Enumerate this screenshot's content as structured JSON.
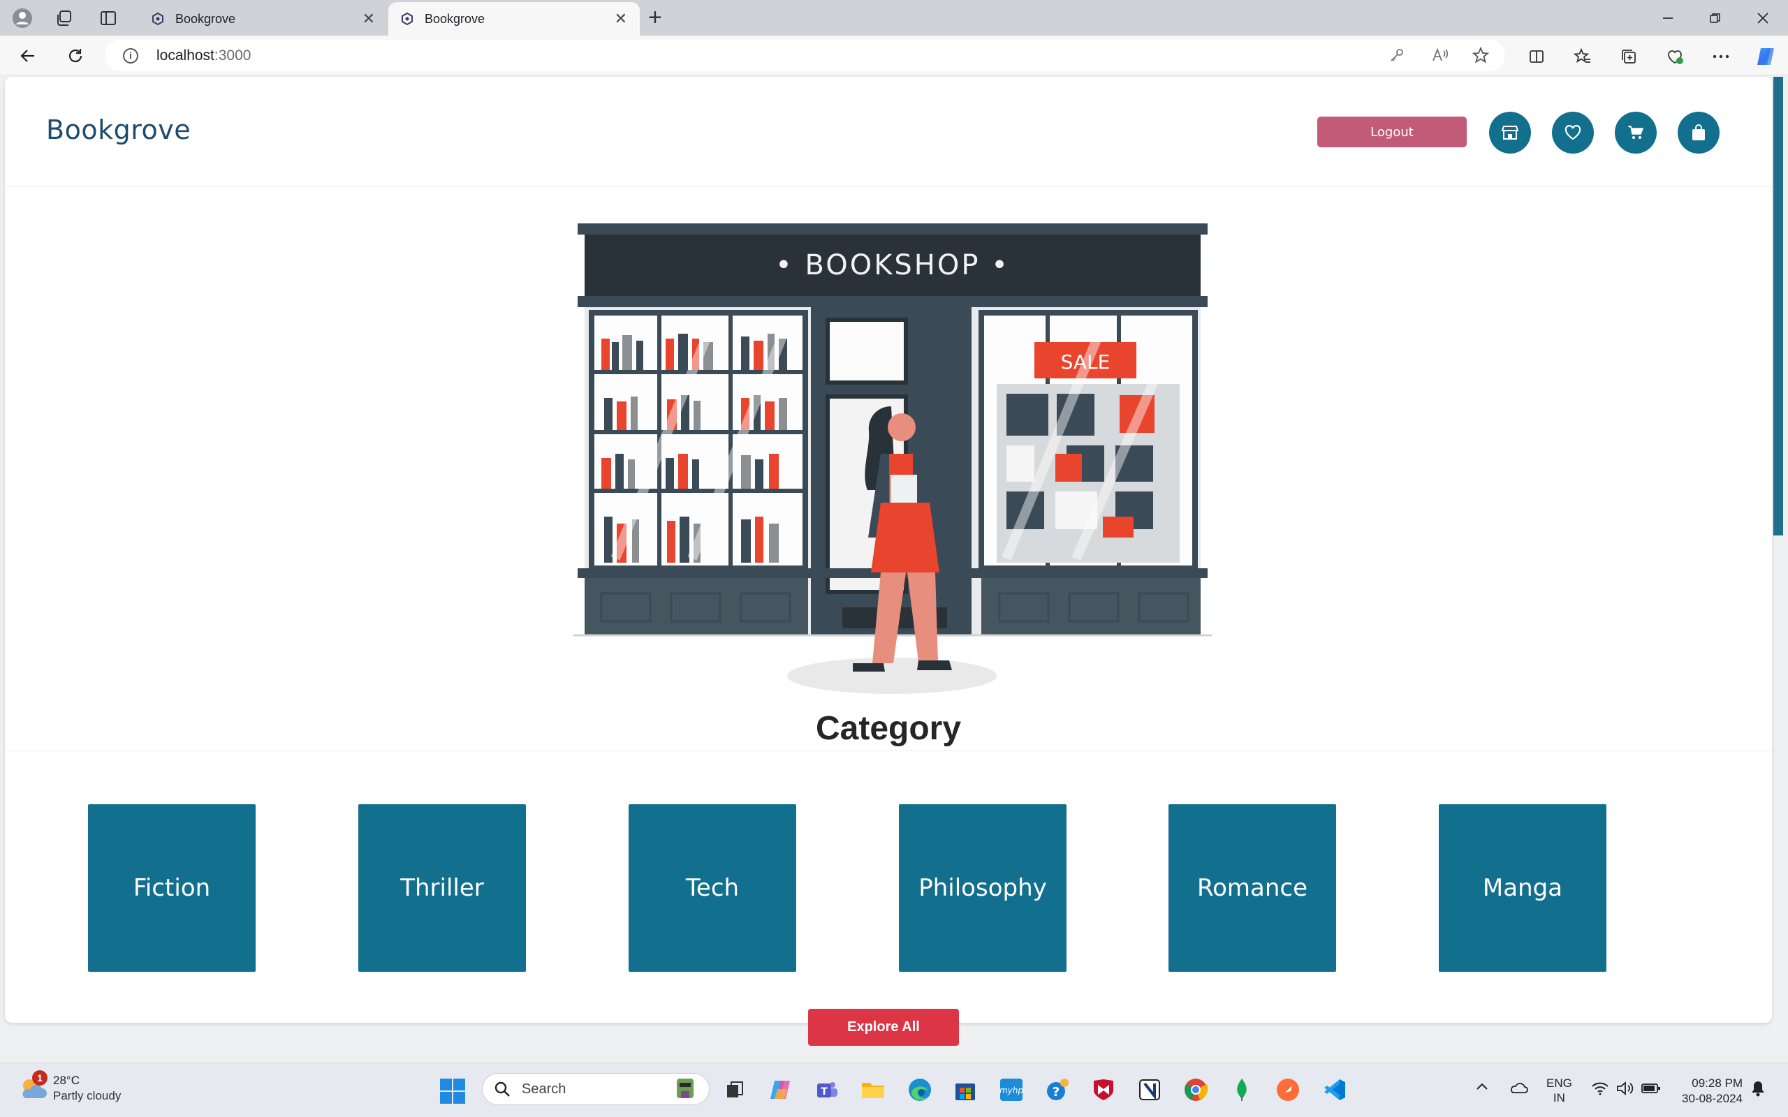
{
  "browser": {
    "tabs": [
      {
        "title": "Bookgrove",
        "active": false
      },
      {
        "title": "Bookgrove",
        "active": true
      }
    ],
    "url_host": "localhost",
    "url_port": ":3000"
  },
  "site": {
    "brand": "Bookgrove",
    "logout_label": "Logout",
    "header_icons": [
      "store-icon",
      "heart-icon",
      "cart-icon",
      "shopping-bag-icon"
    ],
    "accent_color": "#126f8d",
    "logout_color": "#c25b78"
  },
  "hero": {
    "sign_text": "• BOOKSHOP •",
    "sale_text": "SALE"
  },
  "category": {
    "title": "Category",
    "items": [
      "Fiction",
      "Thriller",
      "Tech",
      "Philosophy",
      "Romance",
      "Manga"
    ],
    "explore_label": "Explore All",
    "explore_color": "#dc3545"
  },
  "taskbar": {
    "weather_badge": "1",
    "temperature": "28°C",
    "condition": "Partly cloudy",
    "search_placeholder": "Search",
    "lang_line1": "ENG",
    "lang_line2": "IN",
    "time": "09:28 PM",
    "date": "30-08-2024"
  }
}
